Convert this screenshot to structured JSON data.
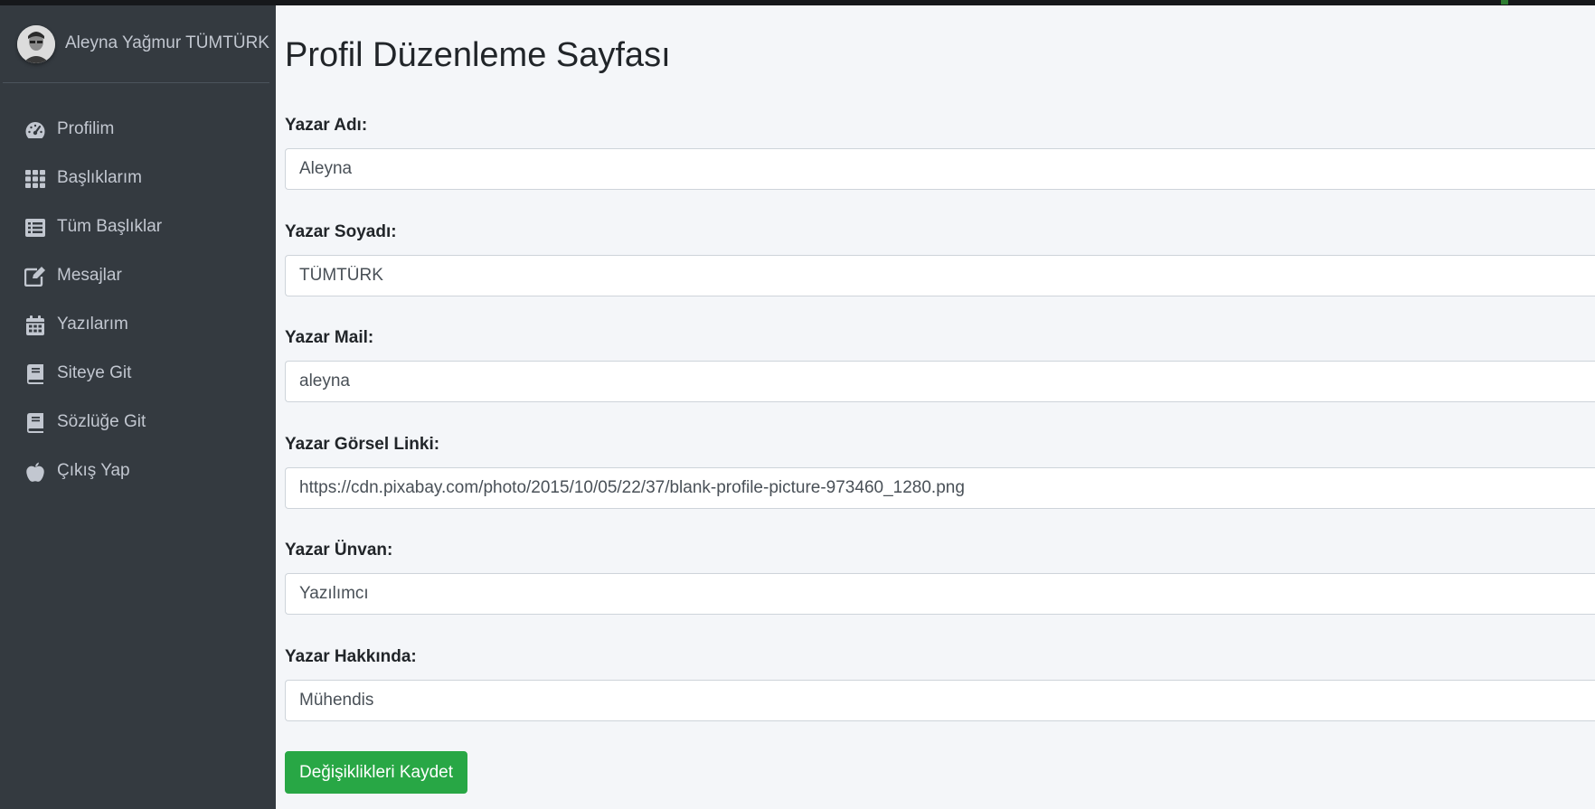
{
  "sidebar": {
    "user": {
      "name": "Aleyna Yağmur TÜMTÜRK"
    },
    "items": [
      {
        "label": "Profilim",
        "icon": "tachometer-icon"
      },
      {
        "label": "Başlıklarım",
        "icon": "grid-icon"
      },
      {
        "label": "Tüm Başlıklar",
        "icon": "list-icon"
      },
      {
        "label": "Mesajlar",
        "icon": "edit-icon"
      },
      {
        "label": "Yazılarım",
        "icon": "calendar-icon"
      },
      {
        "label": "Siteye Git",
        "icon": "book-icon"
      },
      {
        "label": "Sözlüğe Git",
        "icon": "book-icon"
      },
      {
        "label": "Çıkış Yap",
        "icon": "apple-icon"
      }
    ]
  },
  "main": {
    "title": "Profil Düzenleme Sayfası",
    "fields": [
      {
        "label": "Yazar Adı:",
        "value": "Aleyna"
      },
      {
        "label": "Yazar Soyadı:",
        "value": "TÜMTÜRK"
      },
      {
        "label": "Yazar Mail:",
        "value": "aleyna"
      },
      {
        "label": "Yazar Görsel Linki:",
        "value": "https://cdn.pixabay.com/photo/2015/10/05/22/37/blank-profile-picture-973460_1280.png"
      },
      {
        "label": "Yazar Ünvan:",
        "value": "Yazılımcı"
      },
      {
        "label": "Yazar Hakkında:",
        "value": "Mühendis"
      }
    ],
    "save_label": "Değişiklikleri Kaydet"
  },
  "colors": {
    "sidebar_bg": "#343a40",
    "sidebar_text": "#c2c7d0",
    "content_bg": "#f4f6f9",
    "button_success": "#28a745"
  }
}
